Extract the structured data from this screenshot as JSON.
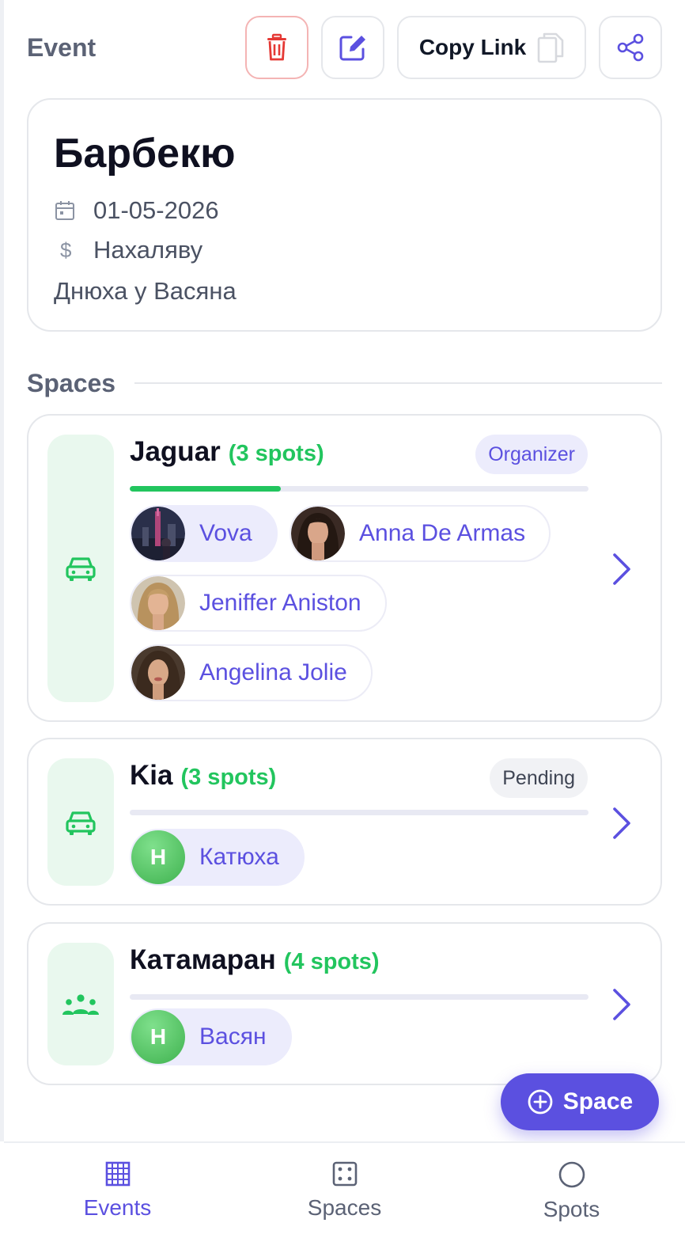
{
  "header": {
    "title": "Event",
    "delete_icon": "trash-icon",
    "edit_icon": "edit-icon",
    "copy_label": "Copy Link",
    "copy_icon": "copy-icon",
    "share_icon": "share-icon"
  },
  "event": {
    "title": "Барбекю",
    "date": "01-05-2026",
    "price": "Нахаляву",
    "description": "Днюха у Васяна"
  },
  "spaces_section": {
    "title": "Spaces"
  },
  "spaces": [
    {
      "name": "Jaguar",
      "spots": "(3 spots)",
      "badge": "Organizer",
      "icon": "car-icon",
      "progress_fraction": 0.33,
      "members": [
        "Vova",
        "Anna De Armas",
        "Jeniffer Aniston",
        "Angelina Jolie"
      ]
    },
    {
      "name": "Kia",
      "spots": "(3 spots)",
      "badge": "Pending",
      "icon": "car-icon",
      "progress_fraction": 0,
      "members": [
        {
          "initial": "H",
          "name": "Катюха"
        }
      ]
    },
    {
      "name": "Катамаран",
      "spots": "(4 spots)",
      "icon": "group-icon",
      "progress_fraction": 0,
      "members": [
        {
          "initial": "H",
          "name": "Васян"
        }
      ]
    }
  ],
  "fab": {
    "label": "Space",
    "icon": "plus-circle-icon"
  },
  "nav": [
    {
      "label": "Events",
      "icon": "grid-icon",
      "active": true
    },
    {
      "label": "Spaces",
      "icon": "dice-icon",
      "active": false
    },
    {
      "label": "Spots",
      "icon": "circle-icon",
      "active": false
    }
  ],
  "colors": {
    "accent": "#5b50e0",
    "success": "#22c55e",
    "danger": "#e53935"
  }
}
